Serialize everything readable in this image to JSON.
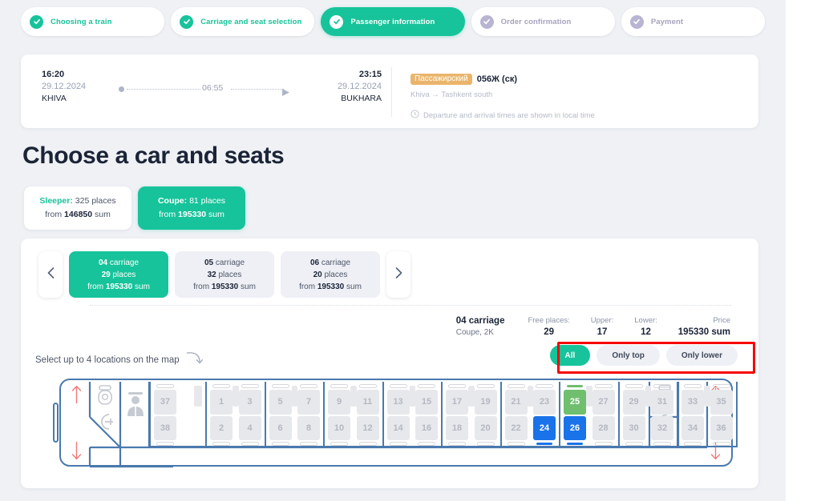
{
  "stepper": {
    "steps": [
      {
        "label": "Choosing a train",
        "state": "done"
      },
      {
        "label": "Carriage and seat selection",
        "state": "done"
      },
      {
        "label": "Passenger information",
        "state": "active"
      },
      {
        "label": "Order confirmation",
        "state": "todo"
      },
      {
        "label": "Payment",
        "state": "todo"
      }
    ]
  },
  "trip": {
    "departure": {
      "time": "16:20",
      "date": "29.12.2024",
      "city": "KHIVA"
    },
    "arrival": {
      "time": "23:15",
      "date": "29.12.2024",
      "city": "BUKHARA"
    },
    "duration": "06:55",
    "train_type_badge": "Пассажирский",
    "train_number": "056Ж (ск)",
    "route": "Khiva → Tashkent south",
    "local_time_note": "Departure and arrival times are shown in local time"
  },
  "page_title": "Choose a car and seats",
  "class_tabs": [
    {
      "name": "Sleeper",
      "places_text": "325 places",
      "from_label": "from",
      "price": "146850",
      "currency": "sum",
      "active": false
    },
    {
      "name": "Coupe",
      "places_text": "81 places",
      "from_label": "from",
      "price": "195330",
      "currency": "sum",
      "active": true
    }
  ],
  "carriage_selector": {
    "prev_icon": "chevron-left-icon",
    "next_icon": "chevron-right-icon",
    "carriages": [
      {
        "number": "04",
        "carriage_word": "carriage",
        "places": "29",
        "places_word": "places",
        "from_label": "from",
        "price": "195330",
        "currency": "sum",
        "active": true
      },
      {
        "number": "05",
        "carriage_word": "carriage",
        "places": "32",
        "places_word": "places",
        "from_label": "from",
        "price": "195330",
        "currency": "sum",
        "active": false
      },
      {
        "number": "06",
        "carriage_word": "carriage",
        "places": "20",
        "places_word": "places",
        "from_label": "from",
        "price": "195330",
        "currency": "sum",
        "active": false
      }
    ]
  },
  "carriage_info": {
    "title": "04 carriage",
    "subtitle": "Coupe, 2K",
    "free_places_label": "Free places:",
    "free_places_value": "29",
    "upper_label": "Upper:",
    "upper_value": "17",
    "lower_label": "Lower:",
    "lower_value": "12",
    "price_label": "Price",
    "price_value": "195330 sum"
  },
  "hint": "Select up to 4 locations on the map",
  "filters": [
    {
      "label": "All",
      "active": true
    },
    {
      "label": "Only top",
      "active": false
    },
    {
      "label": "Only lower",
      "active": false
    }
  ],
  "highlight_box": {
    "color": "#f60202"
  },
  "colors": {
    "brand_green": "#17c39a",
    "seat_free_green": "#6fbf6f",
    "seat_selected_blue": "#1a73e8",
    "seat_disabled_grey": "#e6e8ec",
    "car_outline_blue": "#4a79ad",
    "page_bg": "#eff1f5",
    "badge_orange": "#eab56b",
    "highlight_red": "#f60202"
  },
  "seat_map": {
    "left_end_icons": [
      "toilet-icon",
      "shower-icon",
      "conductor-icon"
    ],
    "right_end_icons": [
      "toilet-icon",
      "shower-icon"
    ],
    "direction_arrow_up": "arrow-up-icon",
    "direction_arrow_down": "arrow-down-icon",
    "compartments": [
      {
        "seats": [
          {
            "number": "37",
            "position": "upper",
            "state": "disabled"
          },
          {
            "number": "38",
            "position": "lower",
            "state": "disabled"
          }
        ],
        "half": true
      },
      {
        "seats": [
          {
            "number": "1",
            "position": "upper",
            "state": "disabled"
          },
          {
            "number": "2",
            "position": "lower",
            "state": "disabled"
          },
          {
            "number": "3",
            "position": "upper",
            "state": "disabled"
          },
          {
            "number": "4",
            "position": "lower",
            "state": "disabled"
          }
        ]
      },
      {
        "seats": [
          {
            "number": "5",
            "position": "upper",
            "state": "disabled"
          },
          {
            "number": "6",
            "position": "lower",
            "state": "disabled"
          },
          {
            "number": "7",
            "position": "upper",
            "state": "disabled"
          },
          {
            "number": "8",
            "position": "lower",
            "state": "disabled"
          }
        ]
      },
      {
        "seats": [
          {
            "number": "9",
            "position": "upper",
            "state": "disabled"
          },
          {
            "number": "10",
            "position": "lower",
            "state": "disabled"
          },
          {
            "number": "11",
            "position": "upper",
            "state": "disabled"
          },
          {
            "number": "12",
            "position": "lower",
            "state": "disabled"
          }
        ]
      },
      {
        "seats": [
          {
            "number": "13",
            "position": "upper",
            "state": "disabled"
          },
          {
            "number": "14",
            "position": "lower",
            "state": "disabled"
          },
          {
            "number": "15",
            "position": "upper",
            "state": "disabled"
          },
          {
            "number": "16",
            "position": "lower",
            "state": "disabled"
          }
        ]
      },
      {
        "seats": [
          {
            "number": "17",
            "position": "upper",
            "state": "disabled"
          },
          {
            "number": "18",
            "position": "lower",
            "state": "disabled"
          },
          {
            "number": "19",
            "position": "upper",
            "state": "disabled"
          },
          {
            "number": "20",
            "position": "lower",
            "state": "disabled"
          }
        ]
      },
      {
        "seats": [
          {
            "number": "21",
            "position": "upper",
            "state": "disabled"
          },
          {
            "number": "22",
            "position": "lower",
            "state": "disabled"
          },
          {
            "number": "23",
            "position": "upper",
            "state": "disabled"
          },
          {
            "number": "24",
            "position": "lower",
            "state": "selected"
          }
        ]
      },
      {
        "seats": [
          {
            "number": "25",
            "position": "upper",
            "state": "free"
          },
          {
            "number": "26",
            "position": "lower",
            "state": "selected"
          },
          {
            "number": "27",
            "position": "upper",
            "state": "disabled"
          },
          {
            "number": "28",
            "position": "lower",
            "state": "disabled"
          }
        ]
      },
      {
        "seats": [
          {
            "number": "29",
            "position": "upper",
            "state": "disabled"
          },
          {
            "number": "30",
            "position": "lower",
            "state": "disabled"
          },
          {
            "number": "31",
            "position": "upper",
            "state": "disabled"
          },
          {
            "number": "32",
            "position": "lower",
            "state": "disabled"
          }
        ]
      },
      {
        "seats": [
          {
            "number": "33",
            "position": "upper",
            "state": "disabled"
          },
          {
            "number": "34",
            "position": "lower",
            "state": "disabled"
          },
          {
            "number": "35",
            "position": "upper",
            "state": "disabled"
          },
          {
            "number": "36",
            "position": "lower",
            "state": "disabled"
          }
        ]
      }
    ]
  }
}
